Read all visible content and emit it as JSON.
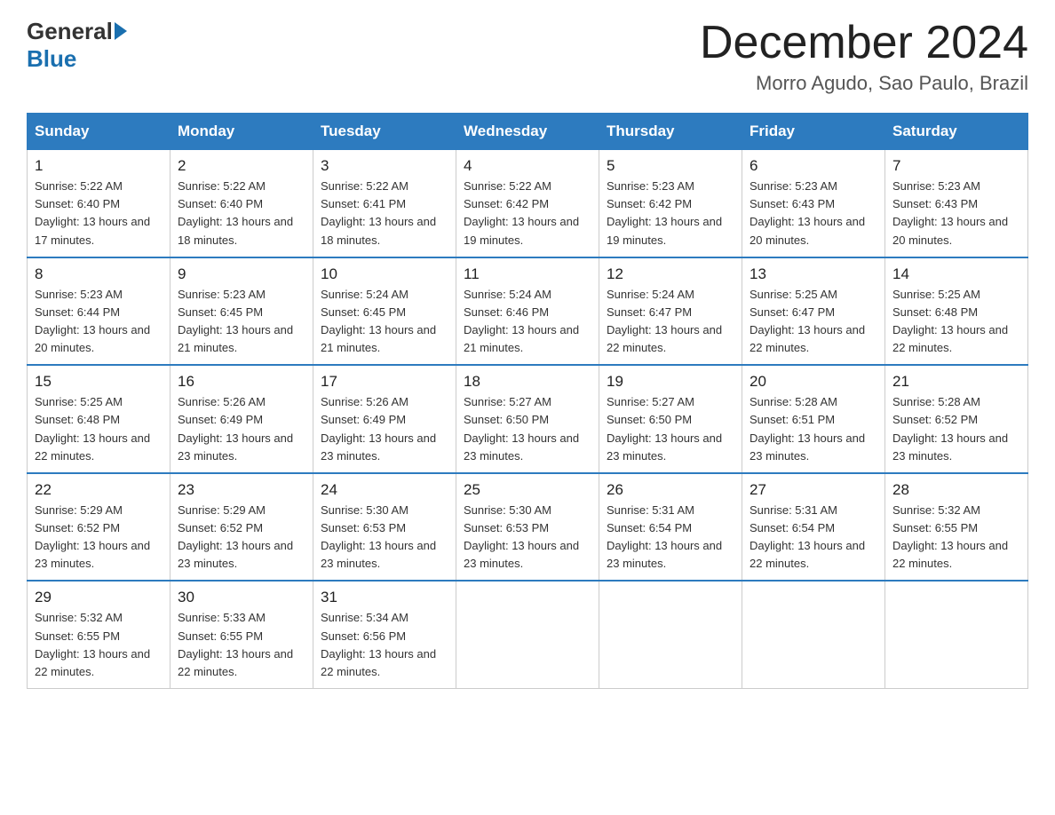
{
  "header": {
    "logo_general": "General",
    "logo_blue": "Blue",
    "title": "December 2024",
    "location": "Morro Agudo, Sao Paulo, Brazil"
  },
  "weekdays": [
    "Sunday",
    "Monday",
    "Tuesday",
    "Wednesday",
    "Thursday",
    "Friday",
    "Saturday"
  ],
  "weeks": [
    [
      {
        "day": "1",
        "sunrise": "5:22 AM",
        "sunset": "6:40 PM",
        "daylight": "13 hours and 17 minutes."
      },
      {
        "day": "2",
        "sunrise": "5:22 AM",
        "sunset": "6:40 PM",
        "daylight": "13 hours and 18 minutes."
      },
      {
        "day": "3",
        "sunrise": "5:22 AM",
        "sunset": "6:41 PM",
        "daylight": "13 hours and 18 minutes."
      },
      {
        "day": "4",
        "sunrise": "5:22 AM",
        "sunset": "6:42 PM",
        "daylight": "13 hours and 19 minutes."
      },
      {
        "day": "5",
        "sunrise": "5:23 AM",
        "sunset": "6:42 PM",
        "daylight": "13 hours and 19 minutes."
      },
      {
        "day": "6",
        "sunrise": "5:23 AM",
        "sunset": "6:43 PM",
        "daylight": "13 hours and 20 minutes."
      },
      {
        "day": "7",
        "sunrise": "5:23 AM",
        "sunset": "6:43 PM",
        "daylight": "13 hours and 20 minutes."
      }
    ],
    [
      {
        "day": "8",
        "sunrise": "5:23 AM",
        "sunset": "6:44 PM",
        "daylight": "13 hours and 20 minutes."
      },
      {
        "day": "9",
        "sunrise": "5:23 AM",
        "sunset": "6:45 PM",
        "daylight": "13 hours and 21 minutes."
      },
      {
        "day": "10",
        "sunrise": "5:24 AM",
        "sunset": "6:45 PM",
        "daylight": "13 hours and 21 minutes."
      },
      {
        "day": "11",
        "sunrise": "5:24 AM",
        "sunset": "6:46 PM",
        "daylight": "13 hours and 21 minutes."
      },
      {
        "day": "12",
        "sunrise": "5:24 AM",
        "sunset": "6:47 PM",
        "daylight": "13 hours and 22 minutes."
      },
      {
        "day": "13",
        "sunrise": "5:25 AM",
        "sunset": "6:47 PM",
        "daylight": "13 hours and 22 minutes."
      },
      {
        "day": "14",
        "sunrise": "5:25 AM",
        "sunset": "6:48 PM",
        "daylight": "13 hours and 22 minutes."
      }
    ],
    [
      {
        "day": "15",
        "sunrise": "5:25 AM",
        "sunset": "6:48 PM",
        "daylight": "13 hours and 22 minutes."
      },
      {
        "day": "16",
        "sunrise": "5:26 AM",
        "sunset": "6:49 PM",
        "daylight": "13 hours and 23 minutes."
      },
      {
        "day": "17",
        "sunrise": "5:26 AM",
        "sunset": "6:49 PM",
        "daylight": "13 hours and 23 minutes."
      },
      {
        "day": "18",
        "sunrise": "5:27 AM",
        "sunset": "6:50 PM",
        "daylight": "13 hours and 23 minutes."
      },
      {
        "day": "19",
        "sunrise": "5:27 AM",
        "sunset": "6:50 PM",
        "daylight": "13 hours and 23 minutes."
      },
      {
        "day": "20",
        "sunrise": "5:28 AM",
        "sunset": "6:51 PM",
        "daylight": "13 hours and 23 minutes."
      },
      {
        "day": "21",
        "sunrise": "5:28 AM",
        "sunset": "6:52 PM",
        "daylight": "13 hours and 23 minutes."
      }
    ],
    [
      {
        "day": "22",
        "sunrise": "5:29 AM",
        "sunset": "6:52 PM",
        "daylight": "13 hours and 23 minutes."
      },
      {
        "day": "23",
        "sunrise": "5:29 AM",
        "sunset": "6:52 PM",
        "daylight": "13 hours and 23 minutes."
      },
      {
        "day": "24",
        "sunrise": "5:30 AM",
        "sunset": "6:53 PM",
        "daylight": "13 hours and 23 minutes."
      },
      {
        "day": "25",
        "sunrise": "5:30 AM",
        "sunset": "6:53 PM",
        "daylight": "13 hours and 23 minutes."
      },
      {
        "day": "26",
        "sunrise": "5:31 AM",
        "sunset": "6:54 PM",
        "daylight": "13 hours and 23 minutes."
      },
      {
        "day": "27",
        "sunrise": "5:31 AM",
        "sunset": "6:54 PM",
        "daylight": "13 hours and 22 minutes."
      },
      {
        "day": "28",
        "sunrise": "5:32 AM",
        "sunset": "6:55 PM",
        "daylight": "13 hours and 22 minutes."
      }
    ],
    [
      {
        "day": "29",
        "sunrise": "5:32 AM",
        "sunset": "6:55 PM",
        "daylight": "13 hours and 22 minutes."
      },
      {
        "day": "30",
        "sunrise": "5:33 AM",
        "sunset": "6:55 PM",
        "daylight": "13 hours and 22 minutes."
      },
      {
        "day": "31",
        "sunrise": "5:34 AM",
        "sunset": "6:56 PM",
        "daylight": "13 hours and 22 minutes."
      },
      null,
      null,
      null,
      null
    ]
  ]
}
